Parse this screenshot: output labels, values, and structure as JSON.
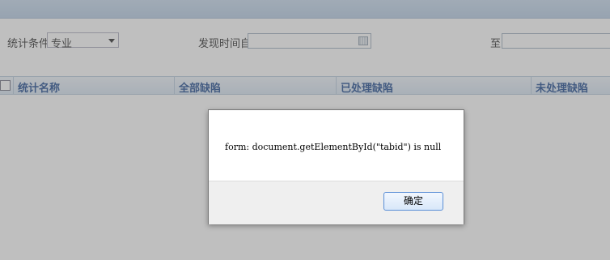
{
  "filters": {
    "condition_label": "统计条件",
    "condition_value": "专业",
    "time_from_label": "发现时间自",
    "time_from_value": "",
    "time_to_label": "至",
    "time_to_value": ""
  },
  "table": {
    "columns": [
      "统计名称",
      "全部缺陷",
      "已处理缺陷",
      "未处理缺陷"
    ]
  },
  "dialog": {
    "message": "form: document.getElementById(\"tabid\") is null",
    "ok_label": "确定"
  },
  "icons": {
    "dropdown": "chevron-down-icon",
    "calendar": "calendar-icon"
  },
  "colors": {
    "header_text": "#15428b",
    "overlay": "#787878",
    "button_border": "#5b8fd6"
  }
}
